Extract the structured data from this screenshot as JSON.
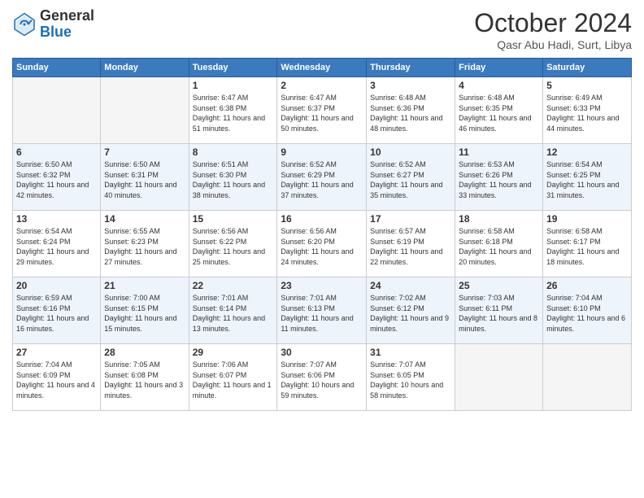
{
  "header": {
    "logo_line1": "General",
    "logo_line2": "Blue",
    "month": "October 2024",
    "location": "Qasr Abu Hadi, Surt, Libya"
  },
  "weekdays": [
    "Sunday",
    "Monday",
    "Tuesday",
    "Wednesday",
    "Thursday",
    "Friday",
    "Saturday"
  ],
  "weeks": [
    [
      {
        "num": "",
        "sunrise": "",
        "sunset": "",
        "daylight": "",
        "empty": true
      },
      {
        "num": "",
        "sunrise": "",
        "sunset": "",
        "daylight": "",
        "empty": true
      },
      {
        "num": "1",
        "sunrise": "Sunrise: 6:47 AM",
        "sunset": "Sunset: 6:38 PM",
        "daylight": "Daylight: 11 hours and 51 minutes.",
        "empty": false
      },
      {
        "num": "2",
        "sunrise": "Sunrise: 6:47 AM",
        "sunset": "Sunset: 6:37 PM",
        "daylight": "Daylight: 11 hours and 50 minutes.",
        "empty": false
      },
      {
        "num": "3",
        "sunrise": "Sunrise: 6:48 AM",
        "sunset": "Sunset: 6:36 PM",
        "daylight": "Daylight: 11 hours and 48 minutes.",
        "empty": false
      },
      {
        "num": "4",
        "sunrise": "Sunrise: 6:48 AM",
        "sunset": "Sunset: 6:35 PM",
        "daylight": "Daylight: 11 hours and 46 minutes.",
        "empty": false
      },
      {
        "num": "5",
        "sunrise": "Sunrise: 6:49 AM",
        "sunset": "Sunset: 6:33 PM",
        "daylight": "Daylight: 11 hours and 44 minutes.",
        "empty": false
      }
    ],
    [
      {
        "num": "6",
        "sunrise": "Sunrise: 6:50 AM",
        "sunset": "Sunset: 6:32 PM",
        "daylight": "Daylight: 11 hours and 42 minutes.",
        "empty": false
      },
      {
        "num": "7",
        "sunrise": "Sunrise: 6:50 AM",
        "sunset": "Sunset: 6:31 PM",
        "daylight": "Daylight: 11 hours and 40 minutes.",
        "empty": false
      },
      {
        "num": "8",
        "sunrise": "Sunrise: 6:51 AM",
        "sunset": "Sunset: 6:30 PM",
        "daylight": "Daylight: 11 hours and 38 minutes.",
        "empty": false
      },
      {
        "num": "9",
        "sunrise": "Sunrise: 6:52 AM",
        "sunset": "Sunset: 6:29 PM",
        "daylight": "Daylight: 11 hours and 37 minutes.",
        "empty": false
      },
      {
        "num": "10",
        "sunrise": "Sunrise: 6:52 AM",
        "sunset": "Sunset: 6:27 PM",
        "daylight": "Daylight: 11 hours and 35 minutes.",
        "empty": false
      },
      {
        "num": "11",
        "sunrise": "Sunrise: 6:53 AM",
        "sunset": "Sunset: 6:26 PM",
        "daylight": "Daylight: 11 hours and 33 minutes.",
        "empty": false
      },
      {
        "num": "12",
        "sunrise": "Sunrise: 6:54 AM",
        "sunset": "Sunset: 6:25 PM",
        "daylight": "Daylight: 11 hours and 31 minutes.",
        "empty": false
      }
    ],
    [
      {
        "num": "13",
        "sunrise": "Sunrise: 6:54 AM",
        "sunset": "Sunset: 6:24 PM",
        "daylight": "Daylight: 11 hours and 29 minutes.",
        "empty": false
      },
      {
        "num": "14",
        "sunrise": "Sunrise: 6:55 AM",
        "sunset": "Sunset: 6:23 PM",
        "daylight": "Daylight: 11 hours and 27 minutes.",
        "empty": false
      },
      {
        "num": "15",
        "sunrise": "Sunrise: 6:56 AM",
        "sunset": "Sunset: 6:22 PM",
        "daylight": "Daylight: 11 hours and 25 minutes.",
        "empty": false
      },
      {
        "num": "16",
        "sunrise": "Sunrise: 6:56 AM",
        "sunset": "Sunset: 6:20 PM",
        "daylight": "Daylight: 11 hours and 24 minutes.",
        "empty": false
      },
      {
        "num": "17",
        "sunrise": "Sunrise: 6:57 AM",
        "sunset": "Sunset: 6:19 PM",
        "daylight": "Daylight: 11 hours and 22 minutes.",
        "empty": false
      },
      {
        "num": "18",
        "sunrise": "Sunrise: 6:58 AM",
        "sunset": "Sunset: 6:18 PM",
        "daylight": "Daylight: 11 hours and 20 minutes.",
        "empty": false
      },
      {
        "num": "19",
        "sunrise": "Sunrise: 6:58 AM",
        "sunset": "Sunset: 6:17 PM",
        "daylight": "Daylight: 11 hours and 18 minutes.",
        "empty": false
      }
    ],
    [
      {
        "num": "20",
        "sunrise": "Sunrise: 6:59 AM",
        "sunset": "Sunset: 6:16 PM",
        "daylight": "Daylight: 11 hours and 16 minutes.",
        "empty": false
      },
      {
        "num": "21",
        "sunrise": "Sunrise: 7:00 AM",
        "sunset": "Sunset: 6:15 PM",
        "daylight": "Daylight: 11 hours and 15 minutes.",
        "empty": false
      },
      {
        "num": "22",
        "sunrise": "Sunrise: 7:01 AM",
        "sunset": "Sunset: 6:14 PM",
        "daylight": "Daylight: 11 hours and 13 minutes.",
        "empty": false
      },
      {
        "num": "23",
        "sunrise": "Sunrise: 7:01 AM",
        "sunset": "Sunset: 6:13 PM",
        "daylight": "Daylight: 11 hours and 11 minutes.",
        "empty": false
      },
      {
        "num": "24",
        "sunrise": "Sunrise: 7:02 AM",
        "sunset": "Sunset: 6:12 PM",
        "daylight": "Daylight: 11 hours and 9 minutes.",
        "empty": false
      },
      {
        "num": "25",
        "sunrise": "Sunrise: 7:03 AM",
        "sunset": "Sunset: 6:11 PM",
        "daylight": "Daylight: 11 hours and 8 minutes.",
        "empty": false
      },
      {
        "num": "26",
        "sunrise": "Sunrise: 7:04 AM",
        "sunset": "Sunset: 6:10 PM",
        "daylight": "Daylight: 11 hours and 6 minutes.",
        "empty": false
      }
    ],
    [
      {
        "num": "27",
        "sunrise": "Sunrise: 7:04 AM",
        "sunset": "Sunset: 6:09 PM",
        "daylight": "Daylight: 11 hours and 4 minutes.",
        "empty": false
      },
      {
        "num": "28",
        "sunrise": "Sunrise: 7:05 AM",
        "sunset": "Sunset: 6:08 PM",
        "daylight": "Daylight: 11 hours and 3 minutes.",
        "empty": false
      },
      {
        "num": "29",
        "sunrise": "Sunrise: 7:06 AM",
        "sunset": "Sunset: 6:07 PM",
        "daylight": "Daylight: 11 hours and 1 minute.",
        "empty": false
      },
      {
        "num": "30",
        "sunrise": "Sunrise: 7:07 AM",
        "sunset": "Sunset: 6:06 PM",
        "daylight": "Daylight: 10 hours and 59 minutes.",
        "empty": false
      },
      {
        "num": "31",
        "sunrise": "Sunrise: 7:07 AM",
        "sunset": "Sunset: 6:05 PM",
        "daylight": "Daylight: 10 hours and 58 minutes.",
        "empty": false
      },
      {
        "num": "",
        "sunrise": "",
        "sunset": "",
        "daylight": "",
        "empty": true
      },
      {
        "num": "",
        "sunrise": "",
        "sunset": "",
        "daylight": "",
        "empty": true
      }
    ]
  ]
}
